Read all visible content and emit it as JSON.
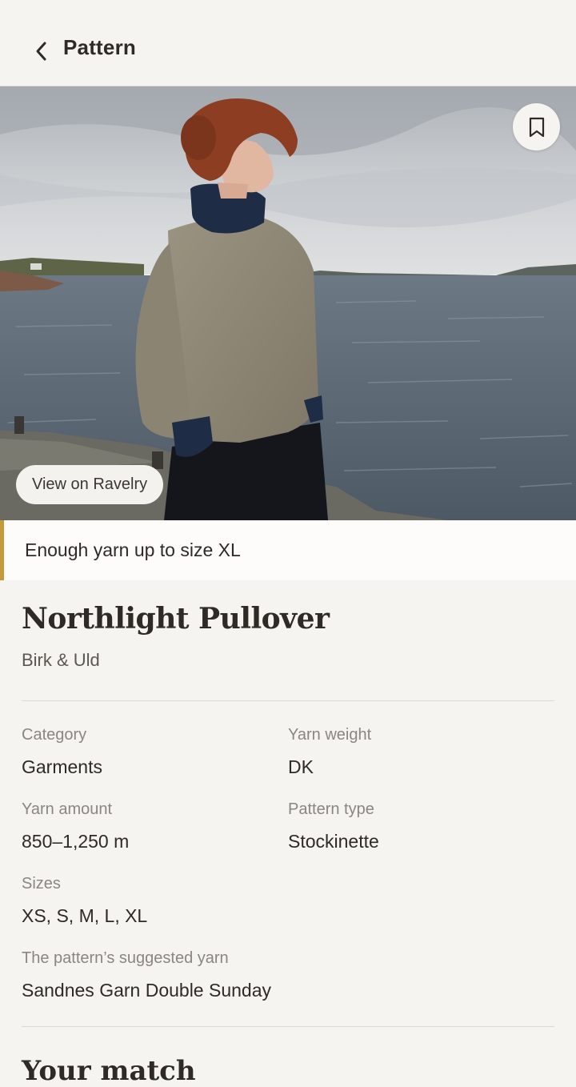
{
  "header": {
    "title": "Pattern",
    "back_icon": "chevron-left-icon"
  },
  "hero": {
    "bookmark_icon": "bookmark-icon",
    "ravelry_label": "View on Ravelry"
  },
  "banner": {
    "text": "Enough yarn up to size XL",
    "accent_color": "#c59a3a"
  },
  "pattern": {
    "name": "Northlight Pullover",
    "designer": "Birk & Uld"
  },
  "specs": {
    "category": {
      "label": "Category",
      "value": "Garments"
    },
    "yarn_weight": {
      "label": "Yarn weight",
      "value": "DK"
    },
    "yarn_amount": {
      "label": "Yarn amount",
      "value": "850–1,250 m"
    },
    "pattern_type": {
      "label": "Pattern type",
      "value": "Stockinette"
    },
    "sizes": {
      "label": "Sizes",
      "value": "XS, S, M, L, XL"
    },
    "suggested_yarn": {
      "label": "The pattern’s suggested yarn",
      "value": "Sandnes Garn Double Sunday"
    }
  },
  "next_section": {
    "heading": "Your match"
  }
}
